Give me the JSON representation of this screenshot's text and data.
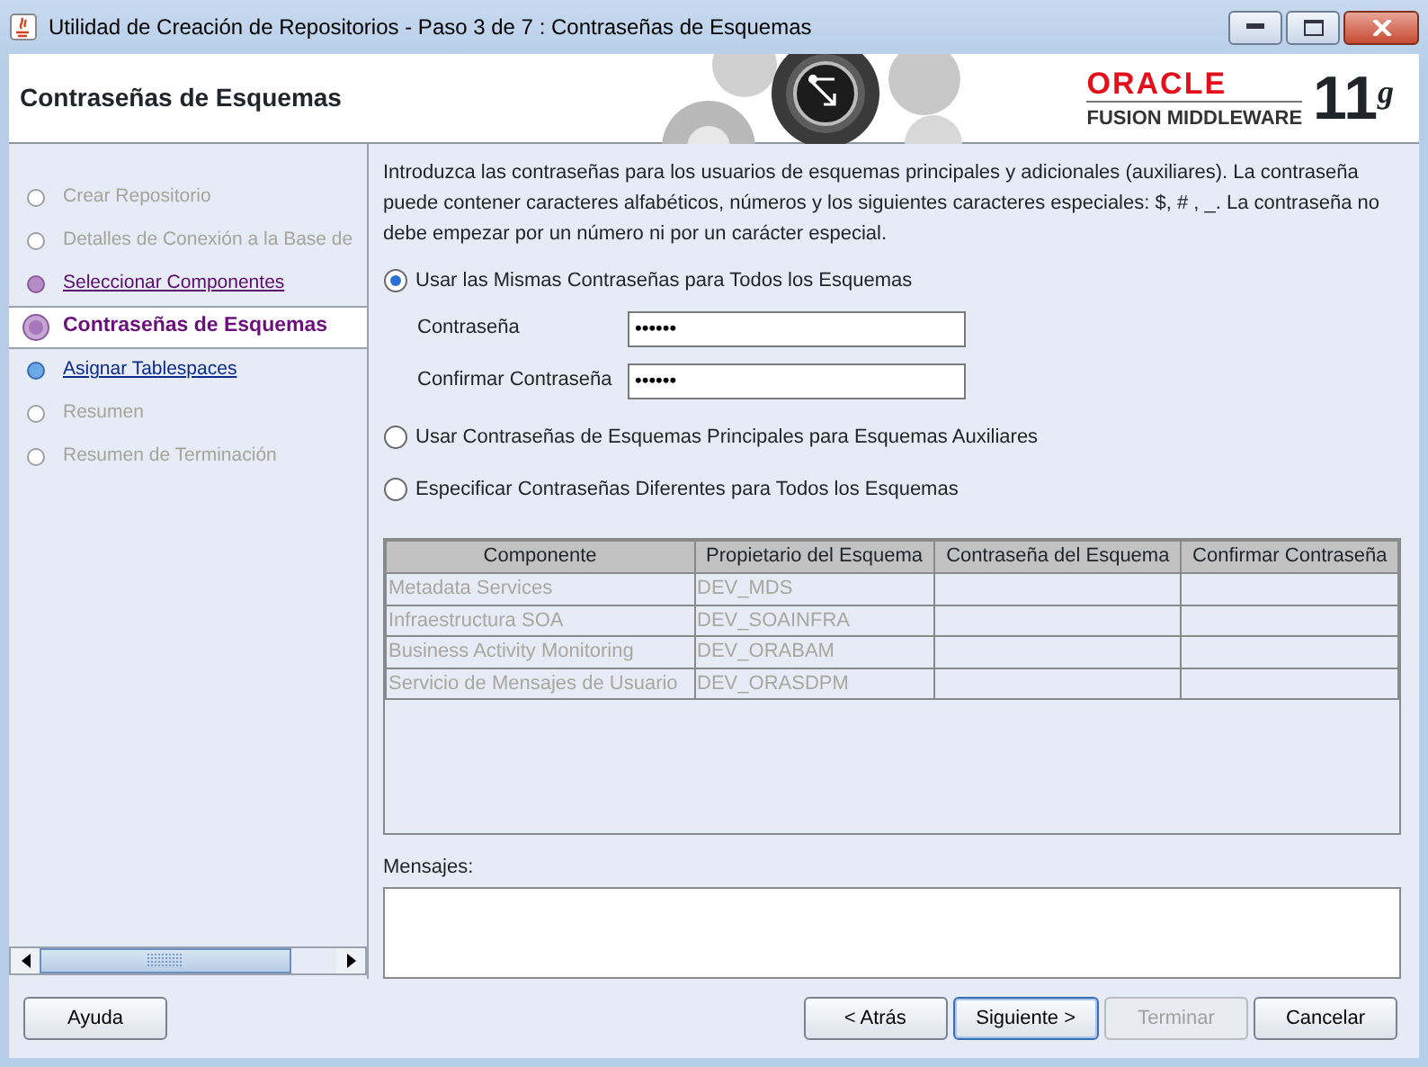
{
  "window": {
    "title": "Utilidad de Creación de Repositorios - Paso 3 de 7 : Contraseñas de Esquemas"
  },
  "header": {
    "title": "Contraseñas de Esquemas",
    "logo_brand": "ORACLE",
    "logo_product": "FUSION MIDDLEWARE",
    "logo_version": "11$^{g}$"
  },
  "steps": [
    {
      "label": "Crear Repositorio",
      "kind": "done"
    },
    {
      "label": "Detalles de Conexión a la Base de",
      "kind": "done"
    },
    {
      "label": "Seleccionar Componentes",
      "kind": "visited"
    },
    {
      "label": "Contraseñas de Esquemas",
      "kind": "current"
    },
    {
      "label": "Asignar Tablespaces",
      "kind": "next"
    },
    {
      "label": "Resumen",
      "kind": "pending"
    },
    {
      "label": "Resumen de Terminación",
      "kind": "pending"
    }
  ],
  "intro": "Introduzca las contraseñas para los usuarios de esquemas principales y adicionales (auxiliares). La contraseña puede contener caracteres alfabéticos, números y los siguientes caracteres especiales: $, # , _. La contraseña no debe empezar por un número ni por un carácter especial.",
  "options": [
    {
      "label": "Usar las Mismas Contraseñas para Todos los Esquemas",
      "selected": true,
      "fields": [
        {
          "label": "Contraseña",
          "value": "••••••"
        },
        {
          "label": "Confirmar Contraseña",
          "value": "••••••"
        }
      ]
    },
    {
      "label": "Usar Contraseñas de Esquemas Principales para Esquemas Auxiliares",
      "selected": false
    },
    {
      "label": "Especificar Contraseñas Diferentes para Todos los Esquemas",
      "selected": false
    }
  ],
  "table": {
    "disabled": true,
    "columns": [
      "Componente",
      "Propietario del Esquema",
      "Contraseña del Esquema",
      "Confirmar Contraseña"
    ],
    "rows": [
      [
        "Metadata Services",
        "DEV_MDS"
      ],
      [
        "Infraestructura SOA",
        "DEV_SOAINFRA"
      ],
      [
        "Business Activity Monitoring",
        "DEV_ORABAM"
      ],
      [
        "Servicio de Mensajes de Usuario",
        "DEV_ORASDPM"
      ]
    ]
  },
  "messages": {
    "label": "Mensajes:"
  },
  "buttons": [
    {
      "label": "Ayuda",
      "disabled": false,
      "default": false,
      "kind": "help"
    },
    {
      "label": "< Atrás",
      "disabled": false,
      "default": false,
      "kind": "nav"
    },
    {
      "label": "Siguiente >",
      "disabled": false,
      "default": true,
      "kind": "nav"
    },
    {
      "label": "Terminar",
      "disabled": true,
      "default": false,
      "kind": "nav"
    },
    {
      "label": "Cancelar",
      "disabled": false,
      "default": false,
      "kind": "nav"
    }
  ]
}
